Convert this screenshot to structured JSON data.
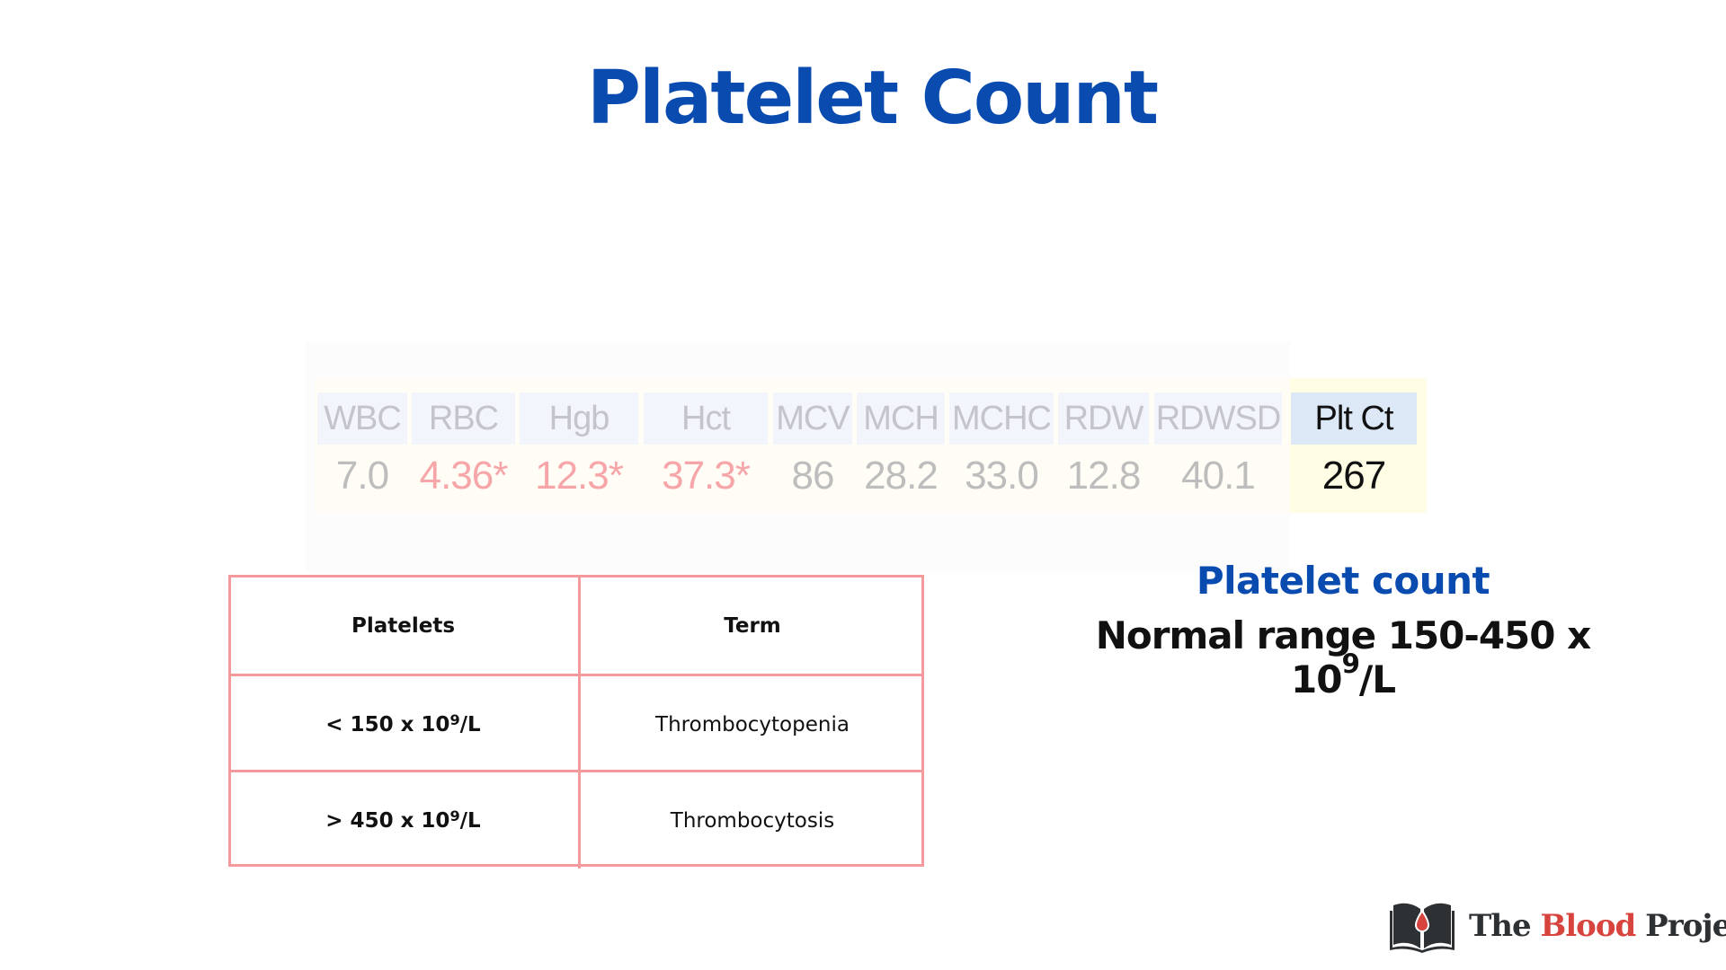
{
  "title": "Platelet Count",
  "lab_panel": {
    "columns": [
      {
        "label": "WBC",
        "value": "7.0",
        "flag": false
      },
      {
        "label": "RBC",
        "value": "4.36*",
        "flag": true
      },
      {
        "label": "Hgb",
        "value": "12.3*",
        "flag": true
      },
      {
        "label": "Hct",
        "value": "37.3*",
        "flag": true
      },
      {
        "label": "MCV",
        "value": "86",
        "flag": false
      },
      {
        "label": "MCH",
        "value": "28.2",
        "flag": false
      },
      {
        "label": "MCHC",
        "value": "33.0",
        "flag": false
      },
      {
        "label": "RDW",
        "value": "12.8",
        "flag": false
      },
      {
        "label": "RDWSD",
        "value": "40.1",
        "flag": false
      },
      {
        "label": "Plt Ct",
        "value": "267",
        "flag": false,
        "highlighted": true
      }
    ]
  },
  "reference_table": {
    "headers": [
      "Platelets",
      "Term"
    ],
    "rows": [
      {
        "range_prefix": "< 150 x 10",
        "range_exp": "9",
        "range_suffix": "/L",
        "term": "Thrombocytopenia"
      },
      {
        "range_prefix": "> 450 x 10",
        "range_exp": "9",
        "range_suffix": "/L",
        "term": "Thrombocytosis"
      }
    ]
  },
  "info": {
    "heading": "Platelet count",
    "range_prefix": "Normal range 150-450 x 10",
    "range_exp": "9",
    "range_suffix": "/L"
  },
  "logo": {
    "part1": "The ",
    "part2": "Blood",
    "part3": " Project"
  },
  "colors": {
    "title_blue": "#0a4bb0",
    "table_border": "#f59a9c",
    "flag_red": "#f6a6a8",
    "logo_red": "#d7443e"
  }
}
